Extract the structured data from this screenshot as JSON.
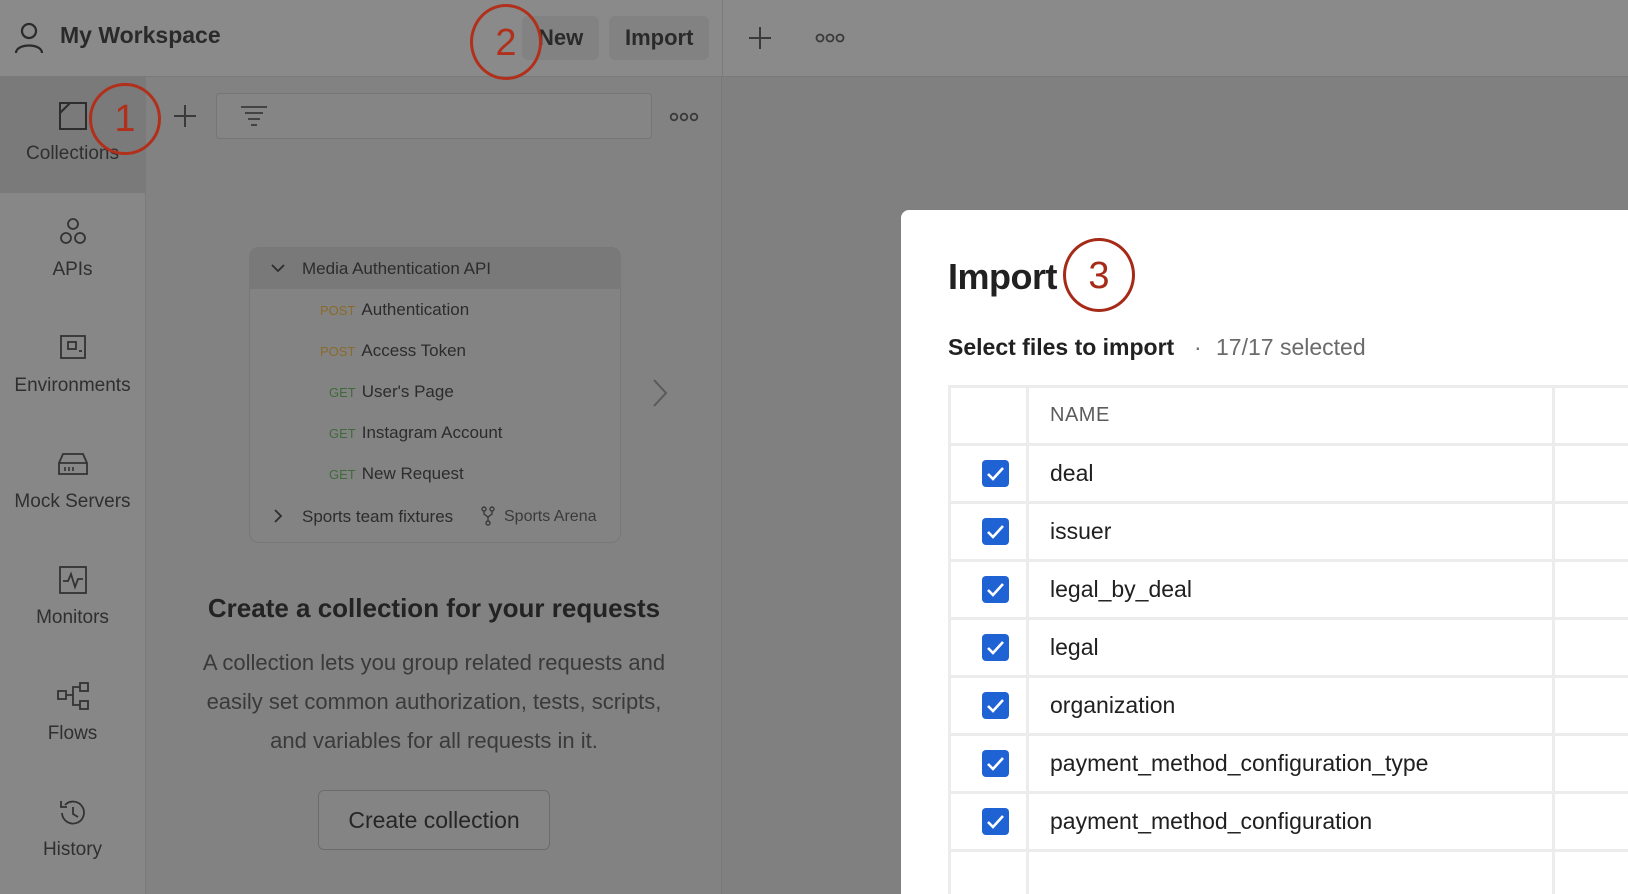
{
  "header": {
    "workspace_title": "My Workspace",
    "new_label": "New",
    "import_label": "Import"
  },
  "rail": {
    "items": [
      {
        "label": "Collections",
        "icon": "collections-icon"
      },
      {
        "label": "APIs",
        "icon": "apis-icon"
      },
      {
        "label": "Environments",
        "icon": "environments-icon"
      },
      {
        "label": "Mock Servers",
        "icon": "mock-servers-icon"
      },
      {
        "label": "Monitors",
        "icon": "monitors-icon"
      },
      {
        "label": "Flows",
        "icon": "flows-icon"
      },
      {
        "label": "History",
        "icon": "history-icon"
      }
    ]
  },
  "preview": {
    "collection_name": "Media Authentication API",
    "requests": [
      {
        "method": "POST",
        "name": "Authentication"
      },
      {
        "method": "POST",
        "name": "Access Token"
      },
      {
        "method": "GET",
        "name": "User's Page"
      },
      {
        "method": "GET",
        "name": "Instagram Account"
      },
      {
        "method": "GET",
        "name": "New Request"
      }
    ],
    "forked_collection": "Sports team fixtures",
    "fork_source": "Sports Arena"
  },
  "empty_state": {
    "title": "Create a collection for your requests",
    "body_lines": [
      "A collection lets you group related requests and",
      "easily set common authorization, tests, scripts,",
      "and variables for all requests in it."
    ],
    "button_label": "Create collection"
  },
  "annotations": [
    "1",
    "2",
    "3"
  ],
  "dialog": {
    "title": "Import",
    "subtitle": "Select files to import",
    "separator": "·",
    "count": "17/17 selected",
    "column_header": "NAME",
    "files": [
      {
        "name": "deal",
        "checked": true
      },
      {
        "name": "issuer",
        "checked": true
      },
      {
        "name": "legal_by_deal",
        "checked": true
      },
      {
        "name": "legal",
        "checked": true
      },
      {
        "name": "organization",
        "checked": true
      },
      {
        "name": "payment_method_configuration_type",
        "checked": true
      },
      {
        "name": "payment_method_configuration",
        "checked": true
      }
    ]
  },
  "colors": {
    "annotation": "#b1301c",
    "checkbox": "#1f62d3",
    "overlay": "#808080"
  }
}
